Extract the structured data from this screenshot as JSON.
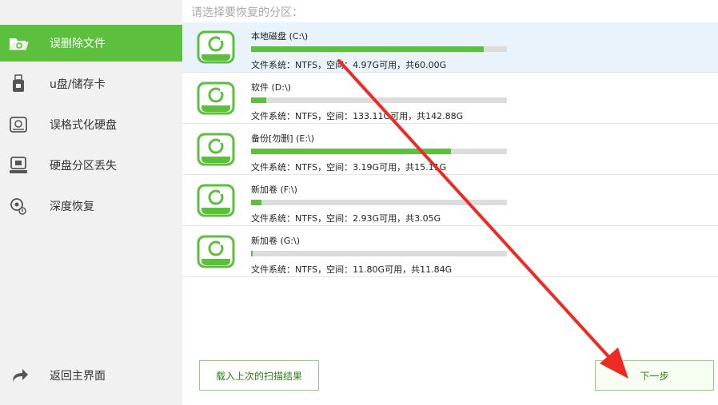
{
  "sidebar": {
    "items": [
      {
        "label": "误删除文件",
        "icon": "folder-icon"
      },
      {
        "label": "u盘/储存卡",
        "icon": "usb-drive-icon"
      },
      {
        "label": "误格式化硬盘",
        "icon": "disk-icon"
      },
      {
        "label": "硬盘分区丢失",
        "icon": "computer-icon"
      },
      {
        "label": "深度恢复",
        "icon": "search-disk-icon"
      }
    ],
    "back_label": "返回主界面"
  },
  "main": {
    "prompt": "请选择要恢复的分区：",
    "partitions": [
      {
        "name": "本地磁盘 (C:\\)",
        "info": "文件系统：NTFS，空间：4.97G可用，共60.00G",
        "used_fraction": 0.91
      },
      {
        "name": "软件 (D:\\)",
        "info": "文件系统：NTFS，空间：133.11G可用，共142.88G",
        "used_fraction": 0.06
      },
      {
        "name": "备份[勿删] (E:\\)",
        "info": "文件系统：NTFS，空间：3.19G可用，共15.11G",
        "used_fraction": 0.78
      },
      {
        "name": "新加卷 (F:\\)",
        "info": "文件系统：NTFS，空间：2.93G可用，共3.05G",
        "used_fraction": 0.04
      },
      {
        "name": "新加卷 (G:\\)",
        "info": "文件系统：NTFS，空间：11.80G可用，共11.84G",
        "used_fraction": 0.005
      }
    ],
    "load_button": "载入上次的扫描结果",
    "next_button": "下一步"
  },
  "colors": {
    "accent": "#5cbf3e",
    "selected_row": "#e8f3fc",
    "annotation_arrow": "#ee2a24"
  }
}
